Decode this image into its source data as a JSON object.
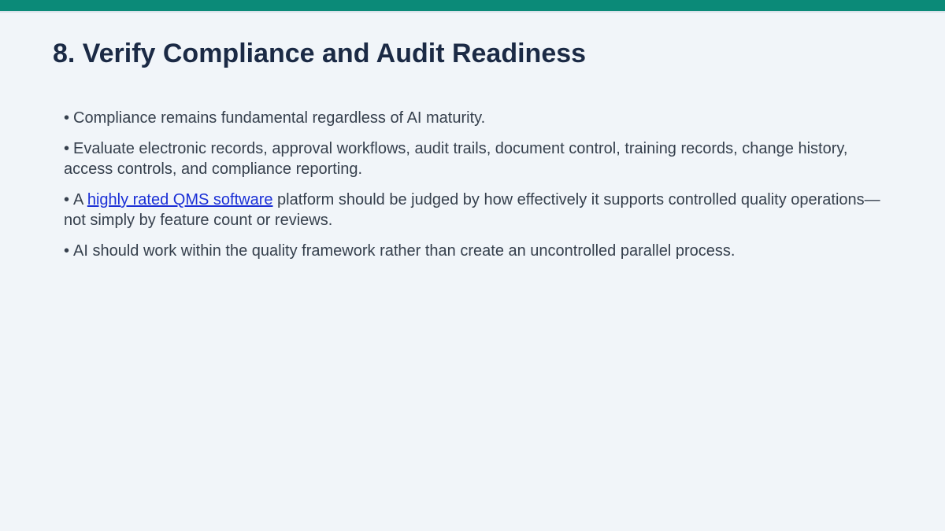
{
  "slide": {
    "title": "8. Verify Compliance and Audit Readiness",
    "bullet_symbol": "•",
    "bullets": [
      {
        "text": "Compliance remains fundamental regardless of AI maturity."
      },
      {
        "text": "Evaluate electronic records, approval workflows, audit trails, document control, training records, change history, access controls, and compliance reporting."
      },
      {
        "text_before": "A",
        "link_text": "highly rated QMS software",
        "text_after": "platform should be judged by how effectively it supports controlled quality operations—not simply by feature count or reviews."
      },
      {
        "text": "AI should work within the quality framework rather than create an uncontrolled parallel process."
      }
    ]
  },
  "colors": {
    "accent_bar": "#0b8a78",
    "background": "#f1f5f9",
    "title": "#1b2a45",
    "body_text": "#36404d",
    "link": "#1a2fd6"
  }
}
